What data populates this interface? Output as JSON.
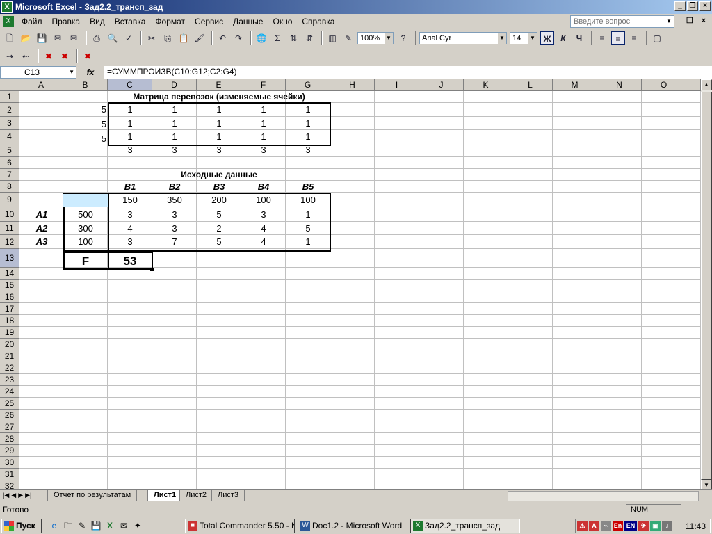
{
  "window": {
    "title": "Microsoft Excel - Зад2.2_трансп_зад"
  },
  "menu": [
    "Файл",
    "Правка",
    "Вид",
    "Вставка",
    "Формат",
    "Сервис",
    "Данные",
    "Окно",
    "Справка"
  ],
  "help": {
    "placeholder": "Введите вопрос"
  },
  "toolbar": {
    "zoom": "100%",
    "font": "Arial Cyr",
    "size": "14",
    "bold": "Ж",
    "italic": "К",
    "underline": "Ч"
  },
  "formula_bar": {
    "cell": "C13",
    "fx": "fx",
    "formula": "=СУММПРОИЗВ(C10:G12;C2:G4)"
  },
  "columns": [
    "A",
    "B",
    "C",
    "D",
    "E",
    "F",
    "G",
    "H",
    "I",
    "J",
    "K",
    "L",
    "M",
    "N",
    "O"
  ],
  "rows": [
    "1",
    "2",
    "3",
    "4",
    "5",
    "6",
    "7",
    "8",
    "9",
    "10",
    "11",
    "12",
    "13",
    "14",
    "15",
    "16",
    "17",
    "18",
    "19",
    "20",
    "21",
    "22",
    "23",
    "24",
    "25",
    "26",
    "27",
    "28",
    "29",
    "30",
    "31",
    "32"
  ],
  "sheet": {
    "title1": "Матрица перевозок (изменяемые ячейки)",
    "matrix_rowsums": [
      "5",
      "5",
      "5"
    ],
    "matrix": [
      [
        "1",
        "1",
        "1",
        "1",
        "1"
      ],
      [
        "1",
        "1",
        "1",
        "1",
        "1"
      ],
      [
        "1",
        "1",
        "1",
        "1",
        "1"
      ]
    ],
    "colsums": [
      "3",
      "3",
      "3",
      "3",
      "3"
    ],
    "title2": "Исходные данные",
    "b_headers": [
      "B1",
      "B2",
      "B3",
      "B4",
      "B5"
    ],
    "demand": [
      "150",
      "350",
      "200",
      "100",
      "100"
    ],
    "a_labels": [
      "A1",
      "A2",
      "A3"
    ],
    "supply": [
      "500",
      "300",
      "100"
    ],
    "costs": [
      [
        "3",
        "3",
        "5",
        "3",
        "1"
      ],
      [
        "4",
        "3",
        "2",
        "4",
        "5"
      ],
      [
        "3",
        "7",
        "5",
        "4",
        "1"
      ]
    ],
    "f_label": "F",
    "f_value": "53"
  },
  "tabs": [
    "Отчет по результатам",
    "Лист1",
    "Лист2",
    "Лист3"
  ],
  "status": {
    "text": "Готово",
    "num": "NUM"
  },
  "taskbar": {
    "start": "Пуск",
    "tasks": [
      "Total Commander 5.50 - N...",
      "Doc1.2 - Microsoft Word",
      "Зад2.2_трансп_зад"
    ],
    "lang1": "En",
    "lang2": "EN",
    "clock": "11:43"
  }
}
